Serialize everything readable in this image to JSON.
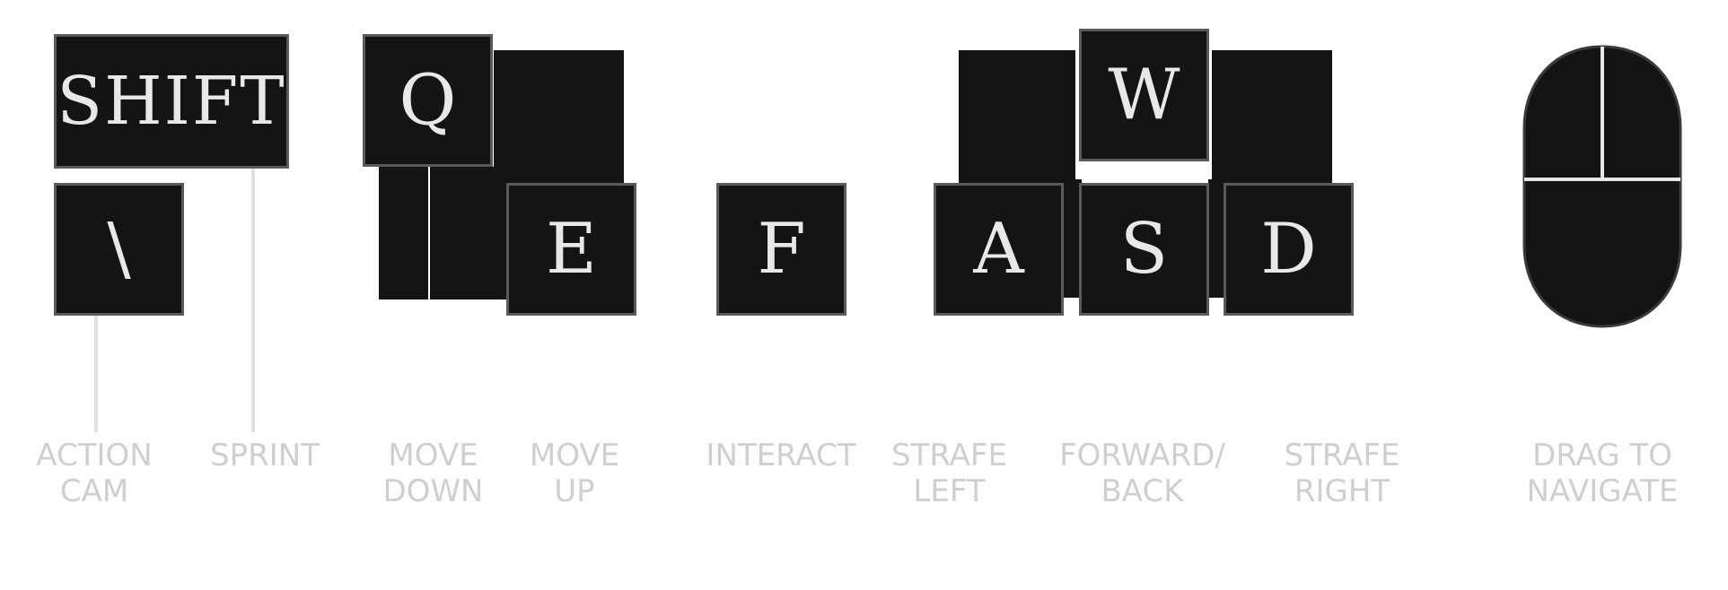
{
  "keys": {
    "shift": "SHIFT",
    "backslash": "\\",
    "q": "Q",
    "e": "E",
    "f": "F",
    "w": "W",
    "a": "A",
    "s": "S",
    "d": "D"
  },
  "labels": {
    "action_cam": "ACTION\nCAM",
    "sprint": "SPRINT",
    "move_down": "MOVE\nDOWN",
    "move_up": "MOVE\nUP",
    "interact": "INTERACT",
    "strafe_left": "STRAFE\nLEFT",
    "forward_back": "FORWARD/\nBACK",
    "strafe_right": "STRAFE\nRIGHT",
    "drag_to_navigate": "DRAG TO\nNAVIGATE"
  },
  "colors": {
    "key_fill": "#141414",
    "key_border": "#5a5a5a",
    "key_text": "#e8e8e8",
    "label_text": "#cfcfcf"
  },
  "icons": {
    "mouse": "mouse-icon"
  }
}
